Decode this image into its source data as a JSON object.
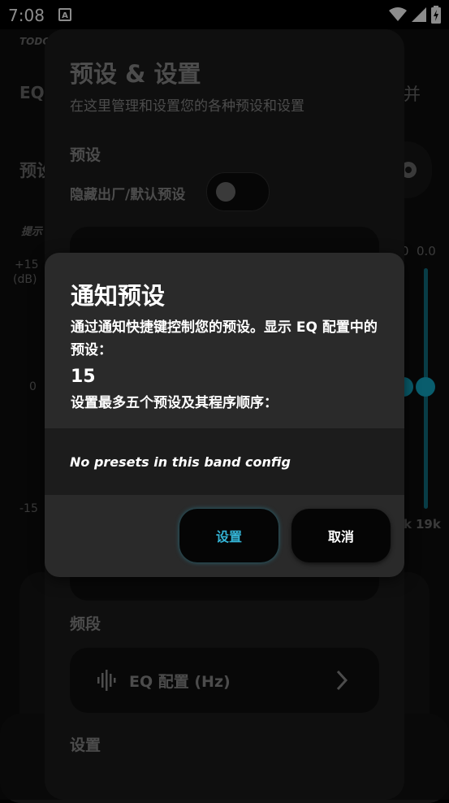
{
  "status_bar": {
    "time": "7:08",
    "notification_glyph": "A"
  },
  "background": {
    "app_label": "TODO",
    "eq_label": "EQ",
    "presets_label": "预设",
    "right_glyph": "并",
    "hint_label": "提示",
    "db_top": "+15",
    "db_unit": "(dB)",
    "db_mid": "0",
    "db_bottom": "-15",
    "freq_values_top": [
      "0",
      "0.0"
    ],
    "freq_labels": [
      "k",
      "19k"
    ]
  },
  "sheet": {
    "title": "预设 & 设置",
    "subtitle": "在这里管理和设置您的各种预设和设置",
    "section_presets": "预设",
    "toggle_label": "隐藏出厂/默认预设",
    "toggle_on": false,
    "section_bands": "频段",
    "band_config_label": "EQ 配置 (Hz)",
    "section_settings": "设置"
  },
  "dialog": {
    "title": "通知预设",
    "description": "通过通知快捷键控制您的预设。显示 EQ 配置中的预设：",
    "count": "15",
    "subtitle": "设置最多五个预设及其程序顺序：",
    "empty_message": "No presets in this band config",
    "set_button": "设置",
    "cancel_button": "取消"
  },
  "colors": {
    "accent": "#34b4d6",
    "dialog_bg": "#2a2a2a",
    "sheet_bg": "#1d1d1d"
  }
}
